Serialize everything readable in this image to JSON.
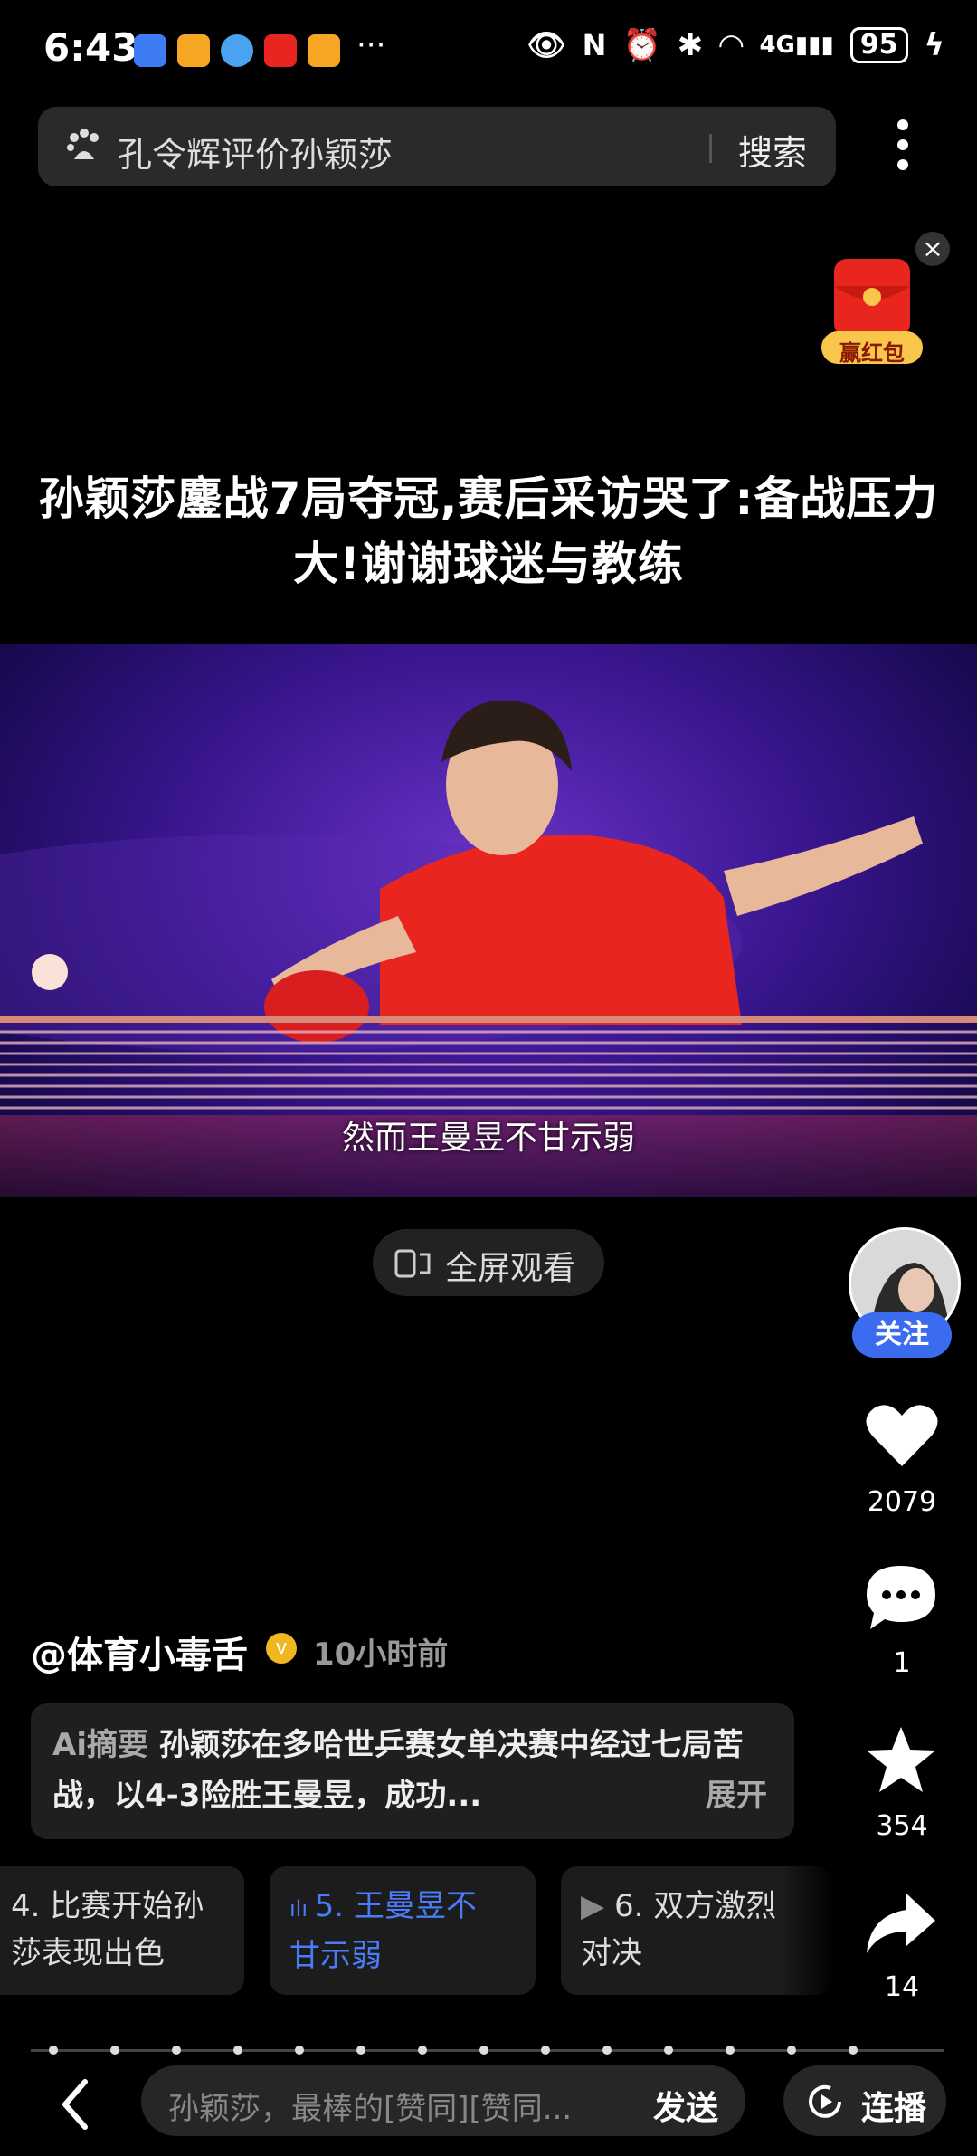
{
  "status_bar": {
    "time": "6:43",
    "more": "···",
    "network": "4G",
    "battery": "95"
  },
  "search": {
    "query": "孔令辉评价孙颖莎",
    "button": "搜索"
  },
  "promo": {
    "label": "赢红包",
    "close": "×"
  },
  "headline": "孙颖莎鏖战7局夺冠,赛后采访哭了:备战压力大!谢谢球迷与教练",
  "video": {
    "subtitle": "然而王曼昱不甘示弱",
    "fullscreen_label": "全屏观看"
  },
  "side": {
    "follow": "关注",
    "likes": "2079",
    "comments": "1",
    "favorites": "354",
    "shares": "14"
  },
  "author": {
    "name": "@体育小毒舌",
    "verified": "v",
    "time": "10小时前"
  },
  "summary": {
    "tag": "Ai摘要",
    "text": "孙颖莎在多哈世乒赛女单决赛中经过七局苦战，以4-3险胜王曼昱，成功...",
    "expand": "展开"
  },
  "chapters": [
    {
      "line1": "4. 比赛开始孙",
      "line2": "莎表现出色"
    },
    {
      "line1": "5. 王曼昱不",
      "line2": "甘示弱"
    },
    {
      "line1": "6. 双方激烈",
      "line2": "对决"
    }
  ],
  "bottom": {
    "comment_placeholder": "孙颖莎，最棒的[赞同][赞同...",
    "send": "发送",
    "continuous": "连播"
  },
  "colors": {
    "accent_blue": "#3b6cf0",
    "active_chapter": "#4a7cf7",
    "jersey_red": "#e8251f"
  }
}
